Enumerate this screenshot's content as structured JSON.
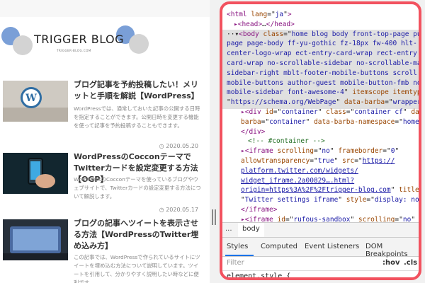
{
  "blog": {
    "logo_text": "TRIGGER BLOG",
    "logo_sub": "TRIGGER-BLOG.COM",
    "posts": [
      {
        "title": "ブログ記事を予約投稿したい！メリットと手順を解説【WordPress】",
        "desc": "WordPressでは、通常しておいた記事の公開する日時を指定することができます。公開日時を変更する機能を使って記事を予約投稿することもできます。",
        "date": ""
      },
      {
        "title": "WordPressのCocconテーマでTwitterカードを設定変更する方法【OGP】",
        "desc": "WordPressのCocconテーマを使っているブログやウェブサイトで、Twitterカードの設定変更する方法について解説します。",
        "date": "2020.05.20"
      },
      {
        "title": "ブログの記事へツイートを表示させる方法【WordPressのTwitter埋め込み方】",
        "desc": "この記事では、WordPressで作られているサイトにツイートを埋め込む方法について説明しています。ツイートを引用して、分かりやすく説明したい時などに便利です。",
        "date": "2020.05.17"
      }
    ]
  },
  "devtools": {
    "code_lines": [
      {
        "indent": 0,
        "parts": [
          [
            "tag",
            "<html "
          ],
          [
            "attr",
            "lang"
          ],
          [
            "txt",
            "=\""
          ],
          [
            "val",
            "ja"
          ],
          [
            "txt",
            "\""
          ],
          [
            "tag",
            ">"
          ]
        ]
      },
      {
        "indent": 1,
        "parts": [
          [
            "tag",
            "▸<head>"
          ],
          [
            "txt",
            "…"
          ],
          [
            "tag",
            "</head>"
          ]
        ]
      },
      {
        "indent": 0,
        "parts": [
          [
            "txt",
            "··▾"
          ],
          [
            "tag",
            "<body "
          ],
          [
            "attr",
            "class"
          ],
          [
            "txt",
            "=\""
          ],
          [
            "val",
            "home blog body front-top-page pub"
          ]
        ]
      },
      {
        "indent": 0,
        "parts": [
          [
            "val",
            "page page-body ff-yu-gothic fz-18px fw-400 hlt-"
          ]
        ]
      },
      {
        "indent": 0,
        "parts": [
          [
            "val",
            "center-logo-wrap ect-entry-card-wrap rect-entry"
          ]
        ]
      },
      {
        "indent": 0,
        "parts": [
          [
            "val",
            "card-wrap no-scrollable-sidebar no-scrollable-ma"
          ]
        ]
      },
      {
        "indent": 0,
        "parts": [
          [
            "val",
            "sidebar-right mblt-footer-mobile-buttons scroll"
          ]
        ]
      },
      {
        "indent": 0,
        "parts": [
          [
            "val",
            "mobile-buttons author-guest mobile-button-fmb no"
          ]
        ]
      },
      {
        "indent": 0,
        "parts": [
          [
            "val",
            "mobile-sidebar font-awesome-4"
          ],
          [
            "txt",
            "\" "
          ],
          [
            "attr",
            "itemscope itemtyp"
          ]
        ]
      },
      {
        "indent": 0,
        "parts": [
          [
            "txt",
            "\""
          ],
          [
            "val",
            "https://schema.org/WebPage"
          ],
          [
            "txt",
            "\" "
          ],
          [
            "attr",
            "data-barba"
          ],
          [
            "txt",
            "=\""
          ],
          [
            "val",
            "wrapper"
          ]
        ]
      },
      {
        "indent": 2,
        "parts": [
          [
            "tag",
            "▸<div "
          ],
          [
            "attr",
            "id"
          ],
          [
            "txt",
            "=\""
          ],
          [
            "val",
            "container"
          ],
          [
            "txt",
            "\" "
          ],
          [
            "attr",
            "class"
          ],
          [
            "txt",
            "=\""
          ],
          [
            "val",
            "container cf"
          ],
          [
            "txt",
            "\" "
          ],
          [
            "attr",
            "data-"
          ]
        ]
      },
      {
        "indent": 2,
        "parts": [
          [
            "attr",
            "barba"
          ],
          [
            "txt",
            "=\""
          ],
          [
            "val",
            "container"
          ],
          [
            "txt",
            "\" "
          ],
          [
            "attr",
            "data-barba-namespace"
          ],
          [
            "txt",
            "=\""
          ],
          [
            "val",
            "home"
          ],
          [
            "txt",
            "\">"
          ]
        ]
      },
      {
        "indent": 2,
        "parts": [
          [
            "tag",
            "</div>"
          ]
        ]
      },
      {
        "indent": 3,
        "parts": [
          [
            "cmt",
            "<!-- #container -->"
          ]
        ]
      },
      {
        "indent": 2,
        "parts": [
          [
            "tag",
            "▸<iframe "
          ],
          [
            "attr",
            "scrolling"
          ],
          [
            "txt",
            "=\""
          ],
          [
            "val",
            "no"
          ],
          [
            "txt",
            "\" "
          ],
          [
            "attr",
            "frameborder"
          ],
          [
            "txt",
            "=\""
          ],
          [
            "val",
            "0"
          ],
          [
            "txt",
            "\""
          ]
        ]
      },
      {
        "indent": 2,
        "parts": [
          [
            "attr",
            "allowtransparency"
          ],
          [
            "txt",
            "=\""
          ],
          [
            "val",
            "true"
          ],
          [
            "txt",
            "\" "
          ],
          [
            "attr",
            "src"
          ],
          [
            "txt",
            "=\""
          ],
          [
            "link",
            "https://"
          ]
        ]
      },
      {
        "indent": 2,
        "parts": [
          [
            "link",
            "platform.twitter.com/widgets/"
          ]
        ]
      },
      {
        "indent": 2,
        "parts": [
          [
            "link",
            "widget_iframe.2a00829….html?"
          ]
        ]
      },
      {
        "indent": 2,
        "parts": [
          [
            "link",
            "origin=https%3A%2F%2Ftrigger-blog.com"
          ],
          [
            "txt",
            "\" "
          ],
          [
            "attr",
            "title"
          ],
          [
            "txt",
            "="
          ]
        ]
      },
      {
        "indent": 2,
        "parts": [
          [
            "txt",
            "\""
          ],
          [
            "val",
            "Twitter settings iframe"
          ],
          [
            "txt",
            "\" "
          ],
          [
            "attr",
            "style"
          ],
          [
            "txt",
            "=\""
          ],
          [
            "val",
            "display: none"
          ]
        ]
      },
      {
        "indent": 2,
        "parts": [
          [
            "tag",
            "</iframe>"
          ]
        ]
      },
      {
        "indent": 2,
        "parts": [
          [
            "tag",
            "▸<iframe "
          ],
          [
            "attr",
            "id"
          ],
          [
            "txt",
            "=\""
          ],
          [
            "val",
            "rufous-sandbox"
          ],
          [
            "txt",
            "\" "
          ],
          [
            "attr",
            "scrolling"
          ],
          [
            "txt",
            "=\""
          ],
          [
            "val",
            "no"
          ],
          [
            "txt",
            "\""
          ]
        ]
      }
    ],
    "breadcrumb": {
      "dots": "...",
      "body": "body"
    },
    "tabs": [
      "Styles",
      "Computed",
      "Event Listeners",
      "DOM Breakpoints"
    ],
    "filter": {
      "placeholder": "Filter",
      "hov": ":hov",
      "cls": ".cls"
    },
    "style_rule": "element.style {"
  }
}
